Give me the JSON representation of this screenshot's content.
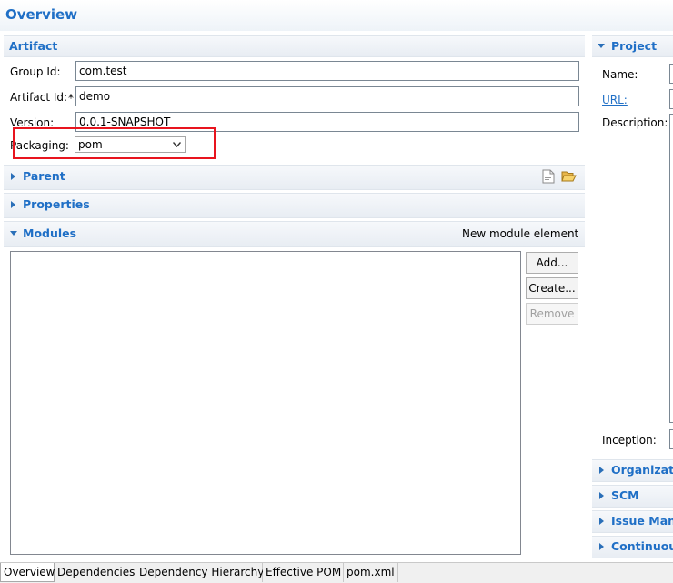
{
  "page": {
    "title": "Overview"
  },
  "artifact": {
    "title": "Artifact",
    "group_id_label": "Group Id:",
    "group_id_value": "com.test",
    "artifact_id_label": "Artifact Id:",
    "required_marker": "*",
    "artifact_id_value": "demo",
    "version_label": "Version:",
    "version_value": "0.0.1-SNAPSHOT",
    "packaging_label": "Packaging:",
    "packaging_value": "pom"
  },
  "sections": {
    "parent": "Parent",
    "properties": "Properties",
    "modules": "Modules"
  },
  "modules": {
    "new_module_link": "New module element",
    "add_button": "Add...",
    "create_button": "Create...",
    "remove_button": "Remove"
  },
  "project": {
    "title": "Project",
    "name_label": "Name:",
    "url_label": "URL:",
    "description_label": "Description:",
    "inception_label": "Inception:"
  },
  "right_sections": [
    "Organizatio",
    "SCM",
    "Issue Mana",
    "Continuous"
  ],
  "tabs": [
    "Overview",
    "Dependencies",
    "Dependency Hierarchy",
    "Effective POM",
    "pom.xml"
  ],
  "colors": {
    "accent": "#1f6fc6",
    "highlight": "#e8141e"
  }
}
